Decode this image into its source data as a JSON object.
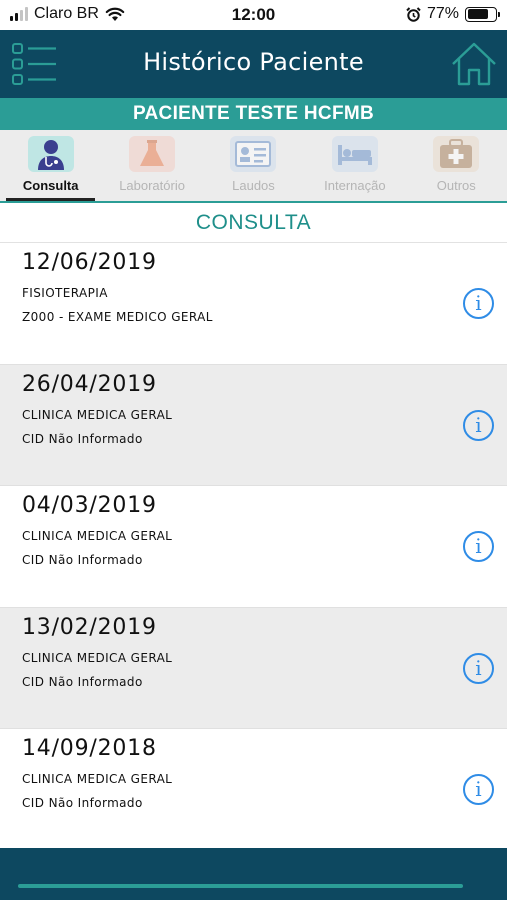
{
  "status_bar": {
    "carrier": "Claro BR",
    "time": "12:00",
    "battery": "77%",
    "battery_level": 0.77,
    "icons": [
      "signal-icon",
      "wifi-icon",
      "alarm-icon",
      "battery-icon"
    ]
  },
  "header": {
    "title": "Histórico Paciente",
    "icons": [
      "list-menu-icon",
      "home-icon"
    ]
  },
  "patient": {
    "name": "PACIENTE TESTE HCFMB"
  },
  "tabs": [
    {
      "label": "Consulta",
      "icon": "doctor-icon",
      "active": true
    },
    {
      "label": "Laboratório",
      "icon": "flask-icon",
      "active": false
    },
    {
      "label": "Laudos",
      "icon": "report-card-icon",
      "active": false
    },
    {
      "label": "Internação",
      "icon": "hospital-bed-icon",
      "active": false
    },
    {
      "label": "Outros",
      "icon": "medical-kit-icon",
      "active": false
    }
  ],
  "section": {
    "title": "CONSULTA"
  },
  "consultations": [
    {
      "date": "12/06/2019",
      "specialty": "FISIOTERAPIA",
      "cid": "Z000 - EXAME MEDICO GERAL",
      "info_icon": "info-icon"
    },
    {
      "date": "26/04/2019",
      "specialty": "CLINICA MEDICA GERAL",
      "cid": "CID Não Informado",
      "info_icon": "info-icon"
    },
    {
      "date": "04/03/2019",
      "specialty": "CLINICA MEDICA GERAL",
      "cid": "CID Não Informado",
      "info_icon": "info-icon"
    },
    {
      "date": "13/02/2019",
      "specialty": "CLINICA MEDICA GERAL",
      "cid": "CID Não Informado",
      "info_icon": "info-icon"
    },
    {
      "date": "14/09/2018",
      "specialty": "CLINICA MEDICA GERAL",
      "cid": "CID Não Informado",
      "info_icon": "info-icon"
    }
  ],
  "info_glyph": "i",
  "colors": {
    "header": "#0d4860",
    "accent": "#2b9d96",
    "info": "#2f8ce6",
    "row_alt": "#ececec"
  }
}
